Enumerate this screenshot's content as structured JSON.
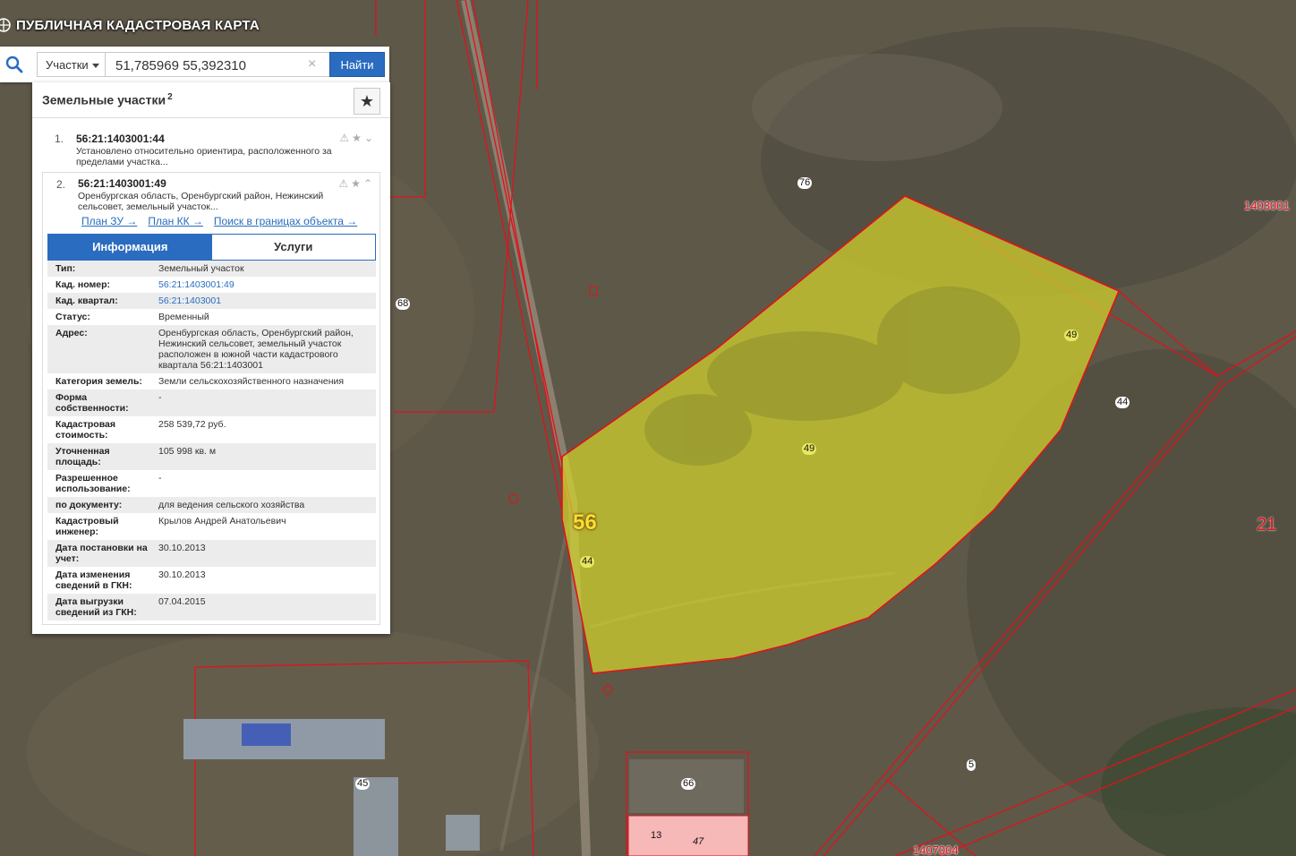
{
  "app": {
    "title": "ПУБЛИЧНАЯ КАДАСТРОВАЯ КАРТА"
  },
  "search": {
    "type_label": "Участки",
    "query": "51,785969 55,392310",
    "button_label": "Найти",
    "clear_glyph": "×"
  },
  "panel": {
    "title": "Земельные участки",
    "count": "2",
    "favorite_glyph": "★",
    "results": [
      {
        "index": "1.",
        "cad_number": "56:21:1403001:44",
        "description": "Установлено относительно ориентира, расположенного за пределами участка..."
      },
      {
        "index": "2.",
        "cad_number": "56:21:1403001:49",
        "description": "Оренбургская область, Оренбургский район, Нежинский сельсовет, земельный участок...",
        "links": [
          "План ЗУ →",
          "План КК →",
          "Поиск в границах объекта →"
        ],
        "tabs": [
          "Информация",
          "Услуги"
        ],
        "info": [
          {
            "label": "Тип:",
            "value": "Земельный участок"
          },
          {
            "label": "Кад. номер:",
            "value": "56:21:1403001:49"
          },
          {
            "label": "Кад. квартал:",
            "value": "56:21:1403001"
          },
          {
            "label": "Статус:",
            "value": "Временный"
          },
          {
            "label": "Адрес:",
            "value": "Оренбургская область, Оренбургский район, Нежинский сельсовет, земельный участок расположен в южной части кадастрового квартала 56:21:1403001"
          },
          {
            "label": "Категория земель:",
            "value": "Земли сельскохозяйственного назначения"
          },
          {
            "label": "Форма собственности:",
            "value": "-"
          },
          {
            "label": "Кадастровая стоимость:",
            "value": "258 539,72 руб."
          },
          {
            "label": "Уточненная площадь:",
            "value": "105 998 кв. м"
          },
          {
            "label": "Разрешенное использование:",
            "value": "-"
          },
          {
            "label": "по документу:",
            "value": "для ведения сельского хозяйства"
          },
          {
            "label": "Кадастровый инженер:",
            "value": "Крылов Андрей Анатольевич"
          },
          {
            "label": "Дата постановки на учет:",
            "value": "30.10.2013"
          },
          {
            "label": "Дата изменения сведений в ГКН:",
            "value": "30.10.2013"
          },
          {
            "label": "Дата выгрузки сведений из ГКН:",
            "value": "07.04.2015"
          }
        ]
      }
    ]
  },
  "map": {
    "labels": [
      "76",
      "68",
      "49",
      "49",
      "44",
      "44",
      "56",
      "21",
      "45",
      "66",
      "13",
      "47",
      "5",
      "1403001",
      "1407004"
    ],
    "colors": {
      "parcel_fill": "#d4d42c",
      "boundary": "#e0121b",
      "highlight": "#f7b8b8"
    }
  }
}
